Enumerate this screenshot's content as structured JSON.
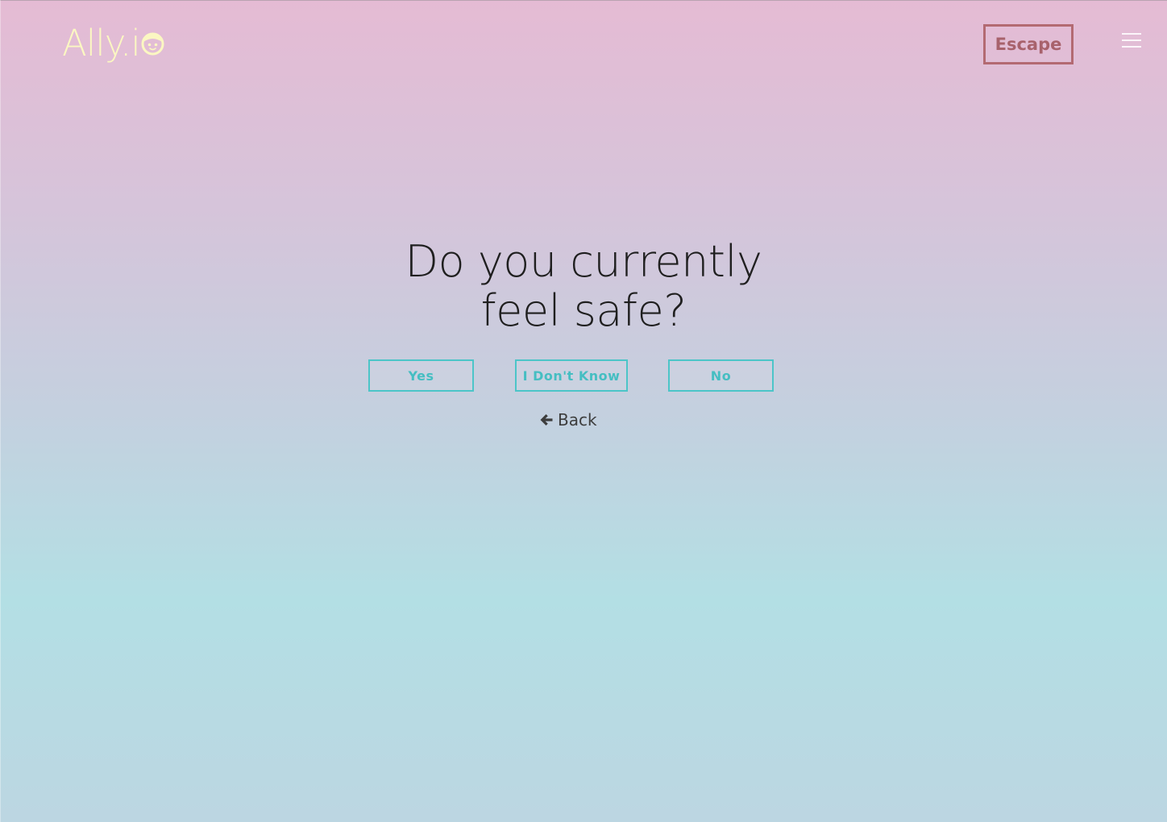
{
  "header": {
    "logo_text": "Ally.i",
    "logo_icon": "smiley-face-icon",
    "escape_label": "Escape",
    "menu_icon": "hamburger-menu-icon"
  },
  "main": {
    "question_line1": "Do you currently",
    "question_line2": "feel safe?",
    "answers": [
      {
        "label": "Yes"
      },
      {
        "label": "I Don't Know"
      },
      {
        "label": "No"
      }
    ],
    "back_label": "Back",
    "back_icon": "arrow-left-icon"
  },
  "colors": {
    "logo": "#fbf7c2",
    "escape": "#b36a72",
    "answer_accent": "#4cc5c8",
    "gradient_top": "#e5bbd4",
    "gradient_bottom": "#b3dfe4"
  }
}
